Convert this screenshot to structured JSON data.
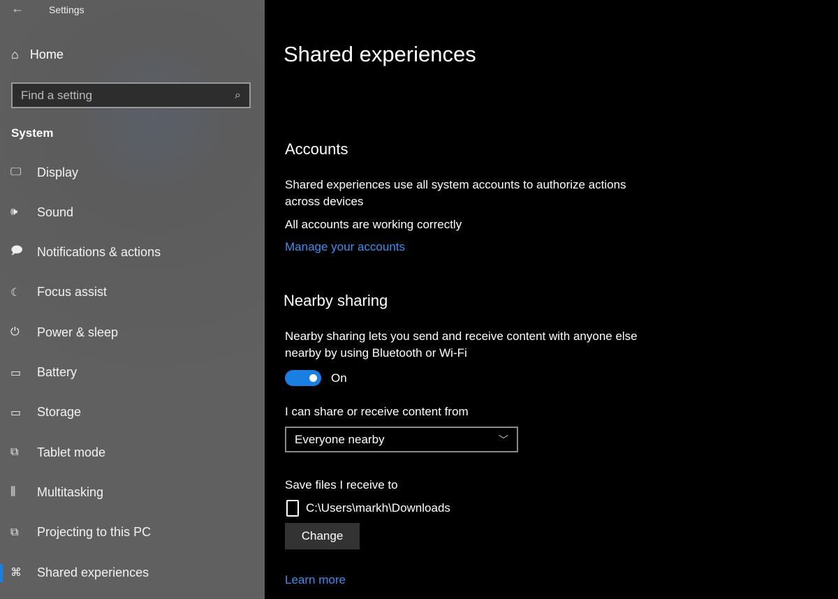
{
  "window": {
    "title": "Settings"
  },
  "sidebar": {
    "home": "Home",
    "search_placeholder": "Find a setting",
    "section": "System",
    "items": [
      {
        "label": "Display",
        "icon": "monitor-icon",
        "glyph": "🖵"
      },
      {
        "label": "Sound",
        "icon": "speaker-icon",
        "glyph": "🕪"
      },
      {
        "label": "Notifications & actions",
        "icon": "notification-icon",
        "glyph": "🗩"
      },
      {
        "label": "Focus assist",
        "icon": "moon-icon",
        "glyph": "☾"
      },
      {
        "label": "Power & sleep",
        "icon": "power-icon",
        "glyph": "⏻"
      },
      {
        "label": "Battery",
        "icon": "battery-icon",
        "glyph": "▭"
      },
      {
        "label": "Storage",
        "icon": "storage-icon",
        "glyph": "▭"
      },
      {
        "label": "Tablet mode",
        "icon": "tablet-mode-icon",
        "glyph": "⧉"
      },
      {
        "label": "Multitasking",
        "icon": "multitasking-icon",
        "glyph": "⫼"
      },
      {
        "label": "Projecting to this PC",
        "icon": "projecting-icon",
        "glyph": "⧉"
      },
      {
        "label": "Shared experiences",
        "icon": "shared-experiences-icon",
        "glyph": "⌘",
        "selected": true
      }
    ]
  },
  "main": {
    "title": "Shared experiences",
    "accounts": {
      "heading": "Accounts",
      "description": "Shared experiences use all system accounts to authorize actions across devices",
      "status": "All accounts are working correctly",
      "link": "Manage your accounts"
    },
    "nearby": {
      "heading": "Nearby sharing",
      "description": "Nearby sharing lets you send and receive content with anyone else nearby by using Bluetooth or Wi-Fi",
      "toggle_state": "On",
      "toggle_on": true,
      "share_label": "I can share or receive content from",
      "share_value": "Everyone nearby",
      "save_label": "Save files I receive to",
      "save_path": "C:\\Users\\markh\\Downloads",
      "change_button": "Change",
      "learn_more": "Learn more"
    }
  },
  "colors": {
    "accent": "#1a7fe0",
    "link": "#3f8ee8",
    "sidebar": "#5e5e5e",
    "background": "#000000"
  }
}
